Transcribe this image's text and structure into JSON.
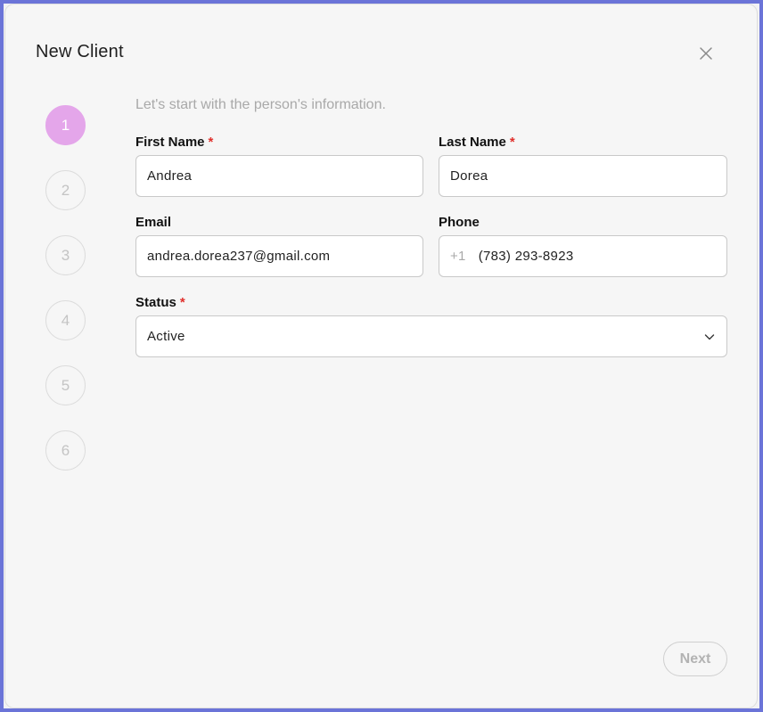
{
  "modal": {
    "title": "New Client",
    "close_icon": "close-icon"
  },
  "stepper": {
    "steps": [
      "1",
      "2",
      "3",
      "4",
      "5",
      "6"
    ],
    "active_step": 1,
    "active_color": "#e4a6ea"
  },
  "form": {
    "intro": "Let's start with the person's information.",
    "first_name": {
      "label": "First Name",
      "required_mark": "*",
      "value": "Andrea"
    },
    "last_name": {
      "label": "Last Name",
      "required_mark": "*",
      "value": "Dorea"
    },
    "email": {
      "label": "Email",
      "value": "andrea.dorea237@gmail.com"
    },
    "phone": {
      "label": "Phone",
      "prefix": "+1",
      "value": "(783) 293-8923"
    },
    "status": {
      "label": "Status",
      "required_mark": "*",
      "value": "Active",
      "icon": "chevron-down-icon"
    }
  },
  "footer": {
    "next_label": "Next"
  },
  "colors": {
    "required": "#e0302c",
    "frame": "#6b74d8"
  }
}
